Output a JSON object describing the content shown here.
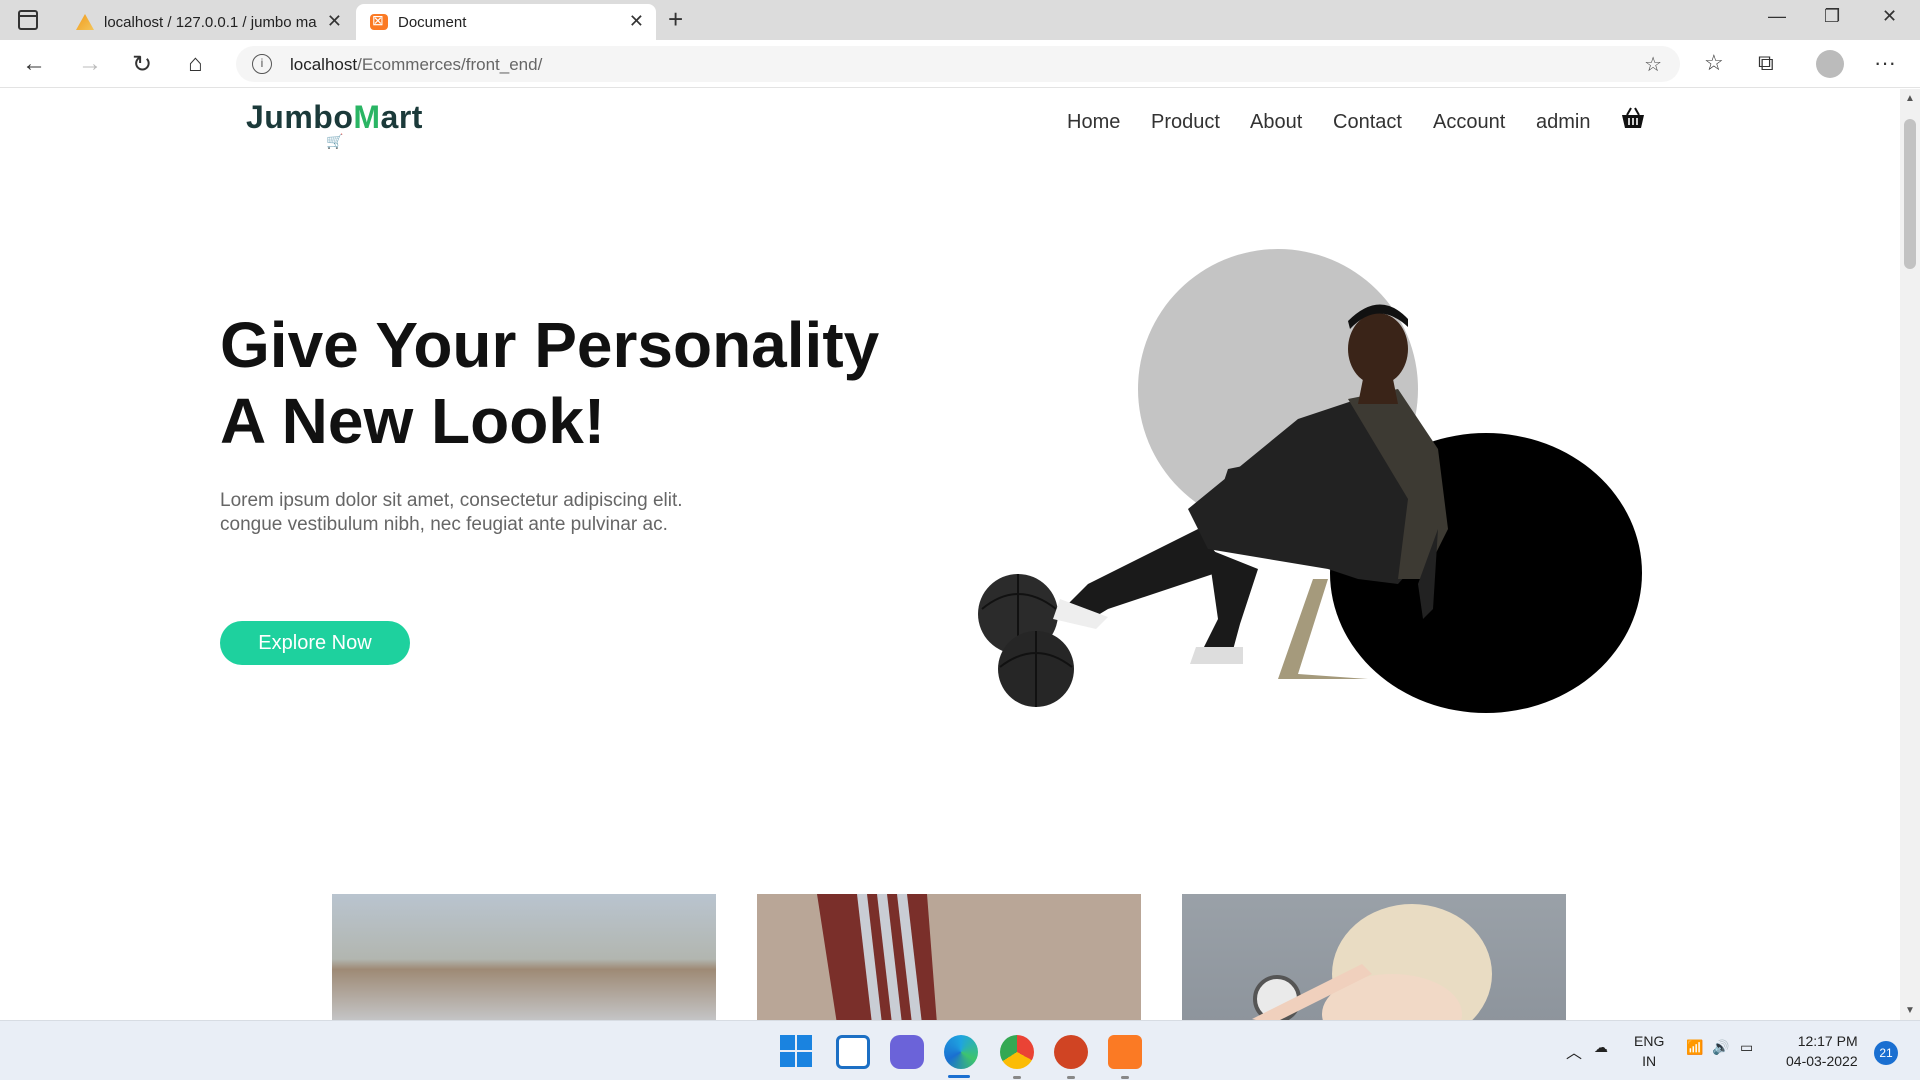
{
  "browser": {
    "tabs": [
      {
        "title": "localhost / 127.0.0.1 / jumbo ma",
        "active": false
      },
      {
        "title": "Document",
        "active": true
      }
    ],
    "url_host": "localhost",
    "url_path": "/Ecommerces/front_end/"
  },
  "site": {
    "logo": {
      "part1": "Jumbo",
      "part2": "M",
      "part3": "art"
    },
    "nav": [
      "Home",
      "Product",
      "About",
      "Contact",
      "Account",
      "admin"
    ],
    "hero": {
      "title_line1": "Give Your Personality",
      "title_line2": "A New Look!",
      "subtitle_line1": "Lorem ipsum dolor sit amet, consectetur adipiscing elit.",
      "subtitle_line2": "congue vestibulum nibh, nec feugiat ante pulvinar ac.",
      "cta": "Explore Now"
    },
    "accent_color": "#1ed19e"
  },
  "taskbar": {
    "lang1": "ENG",
    "lang2": "IN",
    "time": "12:17 PM",
    "date": "04-03-2022",
    "notifications": "21"
  }
}
